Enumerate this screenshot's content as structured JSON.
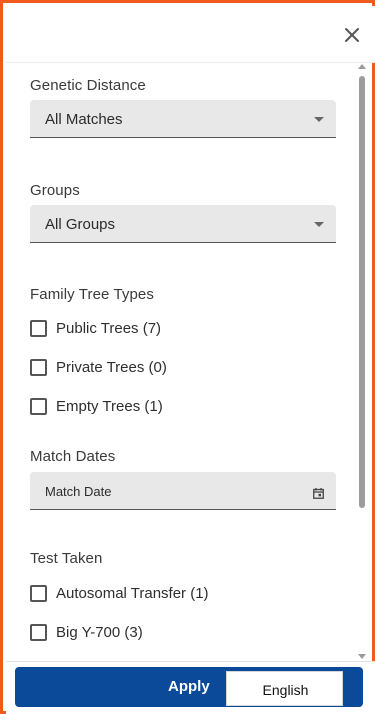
{
  "header": {
    "close_icon": "close-icon"
  },
  "filters": {
    "genetic_distance": {
      "label": "Genetic Distance",
      "value": "All Matches"
    },
    "groups": {
      "label": "Groups",
      "value": "All Groups"
    },
    "family_tree_types": {
      "label": "Family Tree Types",
      "options": [
        "Public Trees (7)",
        "Private Trees (0)",
        "Empty Trees (1)"
      ]
    },
    "match_dates": {
      "label": "Match Dates",
      "placeholder": "Match Date"
    },
    "test_taken": {
      "label": "Test Taken",
      "options": [
        "Autosomal Transfer (1)",
        "Big Y-700 (3)"
      ]
    }
  },
  "footer": {
    "apply_label": "Apply",
    "language": "English"
  },
  "colors": {
    "frame": "#f05a1e",
    "primary": "#0b4a99",
    "field_bg": "#e8e8e8"
  }
}
